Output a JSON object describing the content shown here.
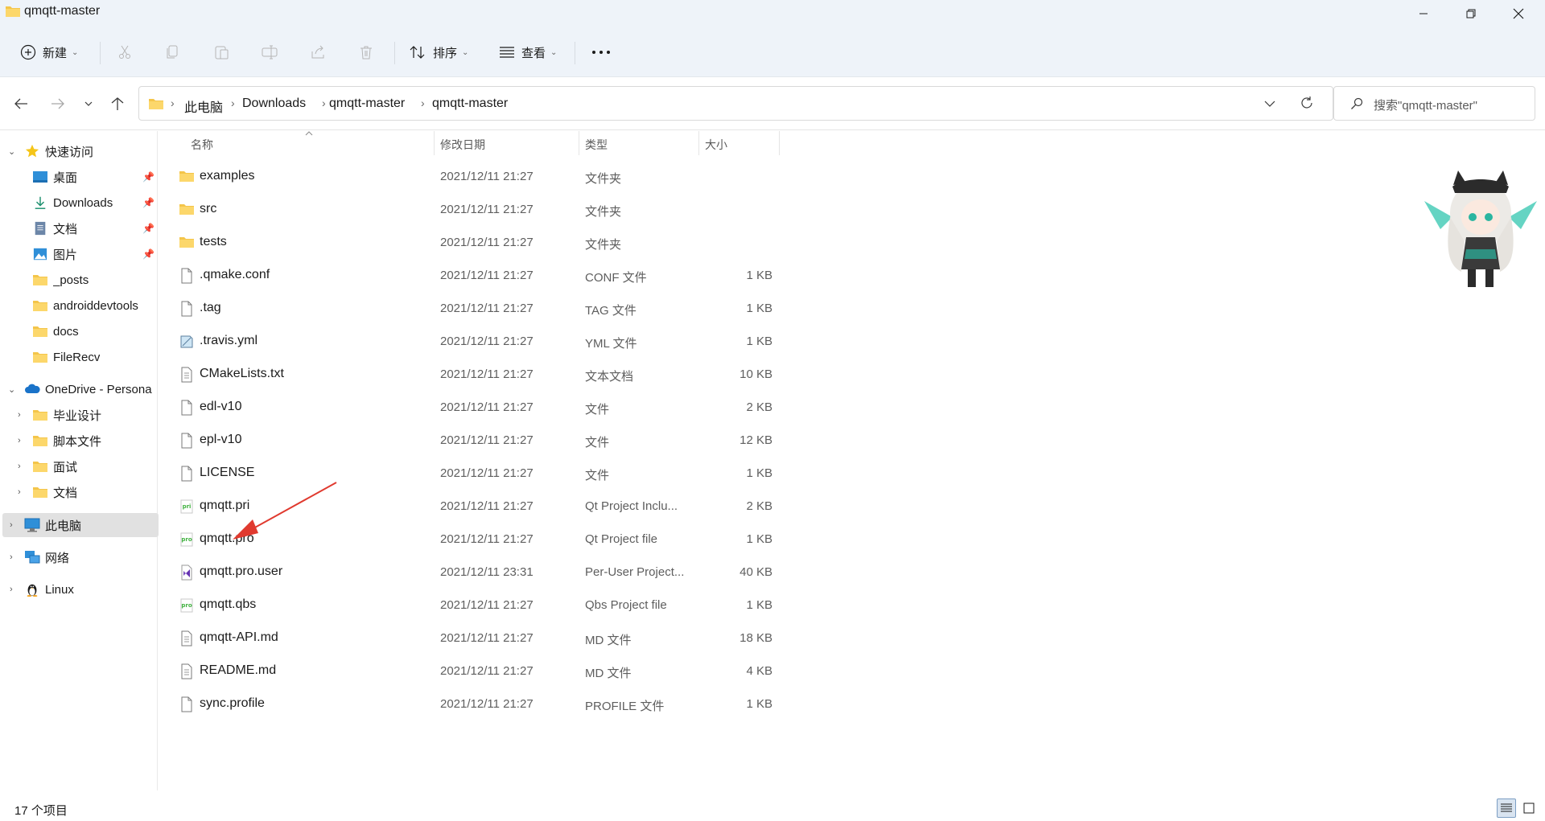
{
  "window": {
    "title": "qmqtt-master"
  },
  "toolbar": {
    "new_label": "新建",
    "sort_label": "排序",
    "view_label": "查看"
  },
  "address": {
    "crumbs": [
      "此电脑",
      "Downloads",
      "qmqtt-master",
      "qmqtt-master"
    ]
  },
  "search": {
    "placeholder": "搜索\"qmqtt-master\""
  },
  "sidebar": {
    "quick_access": "快速访问",
    "quick_items": [
      {
        "label": "桌面",
        "icon": "desktop-icon",
        "pinned": true
      },
      {
        "label": "Downloads",
        "icon": "download-icon",
        "pinned": true
      },
      {
        "label": "文档",
        "icon": "document-icon",
        "pinned": true
      },
      {
        "label": "图片",
        "icon": "picture-icon",
        "pinned": true
      },
      {
        "label": "_posts",
        "icon": "folder-icon",
        "pinned": false
      },
      {
        "label": "androiddevtools",
        "icon": "folder-icon",
        "pinned": false
      },
      {
        "label": "docs",
        "icon": "folder-icon",
        "pinned": false
      },
      {
        "label": "FileRecv",
        "icon": "folder-icon",
        "pinned": false
      }
    ],
    "onedrive": "OneDrive - Persona",
    "onedrive_items": [
      {
        "label": "毕业设计"
      },
      {
        "label": "脚本文件"
      },
      {
        "label": "面试"
      },
      {
        "label": "文档"
      }
    ],
    "this_pc": "此电脑",
    "network": "网络",
    "linux": "Linux"
  },
  "columns": {
    "name": "名称",
    "date": "修改日期",
    "type": "类型",
    "size": "大小"
  },
  "files": [
    {
      "name": "examples",
      "date": "2021/12/11 21:27",
      "type": "文件夹",
      "size": "",
      "icon": "folder-icon"
    },
    {
      "name": "src",
      "date": "2021/12/11 21:27",
      "type": "文件夹",
      "size": "",
      "icon": "folder-icon"
    },
    {
      "name": "tests",
      "date": "2021/12/11 21:27",
      "type": "文件夹",
      "size": "",
      "icon": "folder-icon"
    },
    {
      "name": ".qmake.conf",
      "date": "2021/12/11 21:27",
      "type": "CONF 文件",
      "size": "1 KB",
      "icon": "file-icon"
    },
    {
      "name": ".tag",
      "date": "2021/12/11 21:27",
      "type": "TAG 文件",
      "size": "1 KB",
      "icon": "file-icon"
    },
    {
      "name": ".travis.yml",
      "date": "2021/12/11 21:27",
      "type": "YML 文件",
      "size": "1 KB",
      "icon": "yml-file-icon"
    },
    {
      "name": "CMakeLists.txt",
      "date": "2021/12/11 21:27",
      "type": "文本文档",
      "size": "10 KB",
      "icon": "text-file-icon"
    },
    {
      "name": "edl-v10",
      "date": "2021/12/11 21:27",
      "type": "文件",
      "size": "2 KB",
      "icon": "file-icon"
    },
    {
      "name": "epl-v10",
      "date": "2021/12/11 21:27",
      "type": "文件",
      "size": "12 KB",
      "icon": "file-icon"
    },
    {
      "name": "LICENSE",
      "date": "2021/12/11 21:27",
      "type": "文件",
      "size": "1 KB",
      "icon": "file-icon"
    },
    {
      "name": "qmqtt.pri",
      "date": "2021/12/11 21:27",
      "type": "Qt Project Inclu...",
      "size": "2 KB",
      "icon": "qt-pri-icon"
    },
    {
      "name": "qmqtt.pro",
      "date": "2021/12/11 21:27",
      "type": "Qt Project file",
      "size": "1 KB",
      "icon": "qt-pro-icon"
    },
    {
      "name": "qmqtt.pro.user",
      "date": "2021/12/11 23:31",
      "type": "Per-User Project...",
      "size": "40 KB",
      "icon": "visual-studio-icon"
    },
    {
      "name": "qmqtt.qbs",
      "date": "2021/12/11 21:27",
      "type": "Qbs Project file",
      "size": "1 KB",
      "icon": "qt-pro-icon"
    },
    {
      "name": "qmqtt-API.md",
      "date": "2021/12/11 21:27",
      "type": "MD 文件",
      "size": "18 KB",
      "icon": "text-file-icon"
    },
    {
      "name": "README.md",
      "date": "2021/12/11 21:27",
      "type": "MD 文件",
      "size": "4 KB",
      "icon": "text-file-icon"
    },
    {
      "name": "sync.profile",
      "date": "2021/12/11 21:27",
      "type": "PROFILE 文件",
      "size": "1 KB",
      "icon": "file-icon"
    }
  ],
  "status": {
    "count_text": "17 个项目"
  },
  "colors": {
    "accent": "#0067c0",
    "folder": "#f4c54a",
    "arrow": "#e03a2f",
    "selection": "#e1e1e1"
  }
}
